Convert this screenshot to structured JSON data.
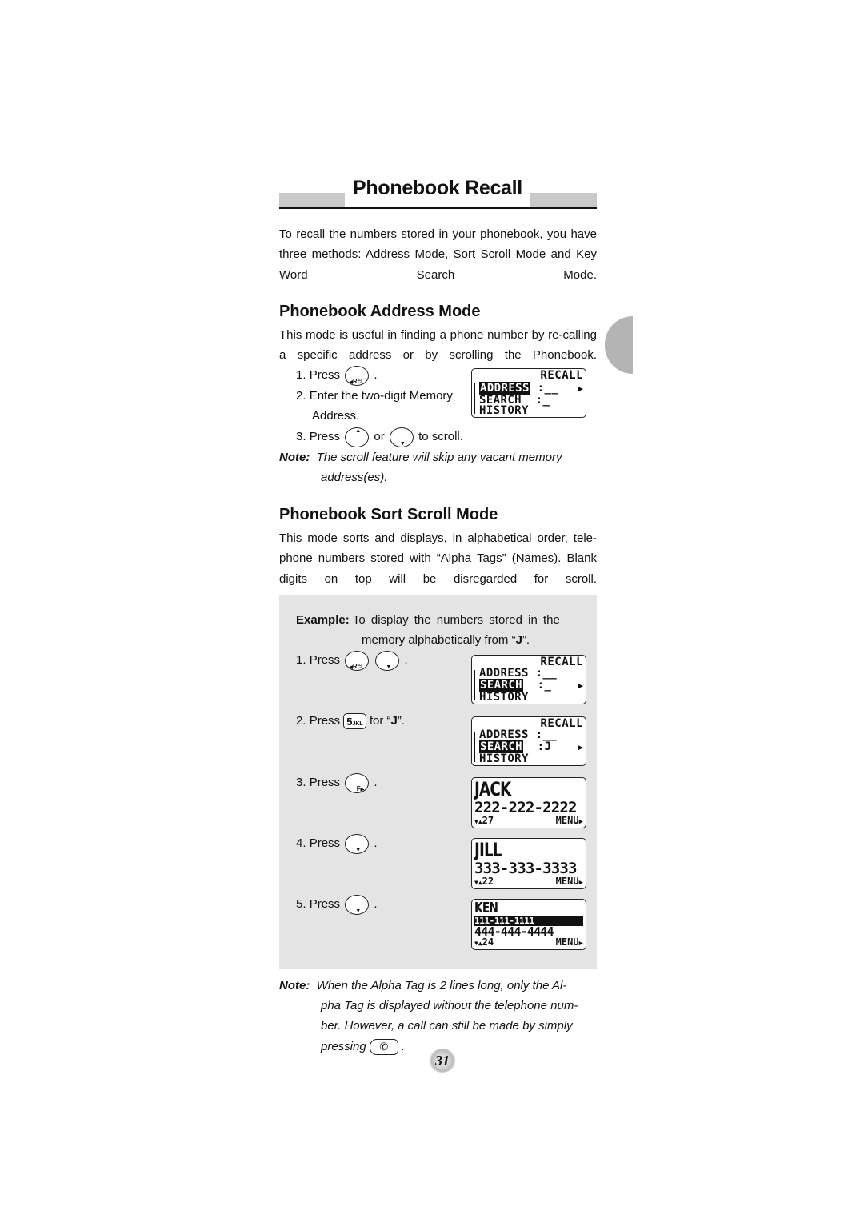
{
  "page": {
    "title": "Phonebook Recall",
    "intro": "To recall the numbers stored in your phonebook, you have three methods: Address Mode, Sort Scroll Mode and Key Word Search Mode.",
    "page_number": "31"
  },
  "address_mode": {
    "heading": "Phonebook Address Mode",
    "description": "This mode is useful in finding a phone number by re-calling a specific address or by scrolling the Phonebook.",
    "steps": [
      {
        "num": "1.",
        "pre": "Press",
        "post": ".",
        "button": "Rcl"
      },
      {
        "num": "2.",
        "text": "Enter the two-digit Memory",
        "text2": "Address."
      },
      {
        "num": "3.",
        "pre": "Press",
        "mid": "or",
        "post": "to scroll."
      }
    ],
    "note_label": "Note:",
    "note_text": "The scroll feature will skip any vacant memory",
    "note_text2": "address(es).",
    "lcd": {
      "header": "RECALL",
      "rows": [
        "ADDRESS",
        "SEARCH",
        "HISTORY"
      ],
      "values": [
        ":__",
        ":_",
        ""
      ],
      "highlighted": "ADDRESS"
    }
  },
  "sort_mode": {
    "heading": "Phonebook Sort Scroll Mode",
    "description": "This mode sorts and displays, in alphabetical order, tele-phone numbers stored with “Alpha Tags” (Names). Blank digits on top will be disregarded for scroll."
  },
  "example": {
    "label": "Example:",
    "text": "To display the numbers stored in the",
    "text2_pre": "memory alphabetically from “",
    "text2_bold": "J",
    "text2_post": "”.",
    "steps": [
      {
        "num": "1.",
        "pre": "Press",
        "post": "."
      },
      {
        "num": "2.",
        "pre": "Press",
        "post_pre": "for “",
        "post_bold": "J",
        "post": "”.",
        "key_digit": "5",
        "key_letters": "JKL"
      },
      {
        "num": "3.",
        "pre": "Press",
        "post": ".",
        "button": "F"
      },
      {
        "num": "4.",
        "pre": "Press",
        "post": "."
      },
      {
        "num": "5.",
        "pre": "Press",
        "post": "."
      }
    ],
    "screens": [
      {
        "header": "RECALL",
        "rows": [
          "ADDRESS",
          "SEARCH",
          "HISTORY"
        ],
        "values": [
          ":__",
          ":_",
          ""
        ],
        "highlighted": "SEARCH"
      },
      {
        "header": "RECALL",
        "rows": [
          "ADDRESS",
          "SEARCH",
          "HISTORY"
        ],
        "values": [
          ":__",
          ":J",
          ""
        ],
        "highlighted": "SEARCH"
      },
      {
        "name": "JACK",
        "number": "222-222-2222",
        "memory": "27",
        "menu": "MENU"
      },
      {
        "name": "JILL",
        "number": "333-333-3333",
        "memory": "22",
        "menu": "MENU"
      },
      {
        "name": "KEN",
        "number_hidden": "111-111-1111",
        "number": "444-444-4444",
        "memory": "24",
        "menu": "MENU"
      }
    ]
  },
  "final_note": {
    "label": "Note:",
    "lines": [
      "When the Alpha Tag is 2 lines long, only the Al-",
      "pha Tag is displayed without the telephone num-",
      "ber. However, a call can still be made by simply"
    ],
    "last_pre": "pressing",
    "last_post": "."
  },
  "icons": {
    "up_arrow": "▲",
    "down_arrow": "▼",
    "right_arrow": "▶",
    "left_arrow": "◀",
    "handset": "✆",
    "scroll_updown": "▼▲"
  }
}
